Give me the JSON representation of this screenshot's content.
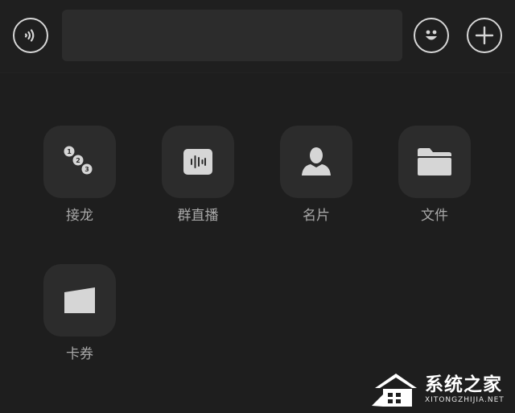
{
  "input_bar": {
    "voice_icon": "voice-wave-icon",
    "message_value": "",
    "emoji_icon": "smiley-face-icon",
    "more_icon": "plus-icon"
  },
  "panel": {
    "tiles": [
      {
        "label": "接龙",
        "icon": "numbered-sequence-icon"
      },
      {
        "label": "群直播",
        "icon": "live-audio-wave-icon"
      },
      {
        "label": "名片",
        "icon": "person-card-icon"
      },
      {
        "label": "文件",
        "icon": "folder-icon"
      },
      {
        "label": "卡券",
        "icon": "card-voucher-icon"
      }
    ]
  },
  "watermark": {
    "title": "系统之家",
    "subtitle": "XITONGZHIJIA.NET"
  },
  "colors": {
    "background": "#1e1e1e",
    "tile_background": "#2c2c2c",
    "label": "#a8a8a8",
    "icon": "#d6d6d6"
  }
}
